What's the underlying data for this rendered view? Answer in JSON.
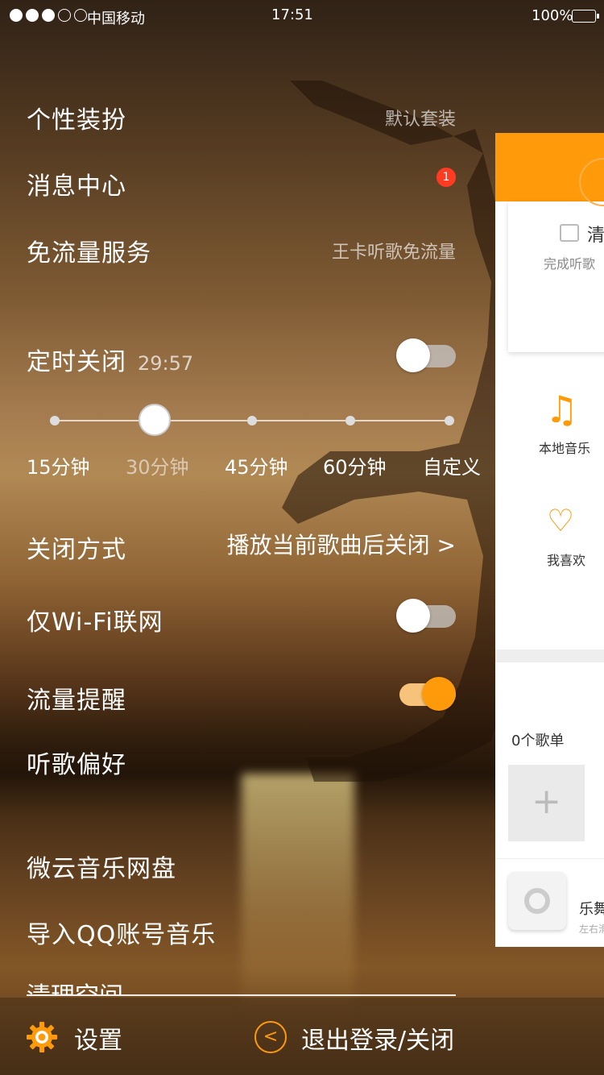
{
  "status_bar": {
    "carrier": "中国移动",
    "time": "17:51",
    "battery": "100%",
    "signal_filled": 3,
    "signal_total": 5
  },
  "menu": {
    "theme": {
      "label": "个性装扮",
      "value": "默认套装"
    },
    "messages": {
      "label": "消息中心",
      "badge": "1"
    },
    "free_data": {
      "label": "免流量服务",
      "value": "王卡听歌免流量"
    },
    "timer": {
      "label": "定时关闭",
      "countdown": "29:57",
      "enabled": false,
      "options": [
        "15分钟",
        "30分钟",
        "45分钟",
        "60分钟",
        "自定义"
      ],
      "selected_index": 1
    },
    "close_mode": {
      "label": "关闭方式",
      "value": "播放当前歌曲后关闭 >"
    },
    "wifi_only": {
      "label": "仅Wi-Fi联网",
      "enabled": false
    },
    "data_alert": {
      "label": "流量提醒",
      "enabled": true
    },
    "preferences": {
      "label": "听歌偏好"
    },
    "weiyun": {
      "label": "微云音乐网盘"
    },
    "import_qq": {
      "label": "导入QQ账号音乐"
    },
    "clear_space": {
      "label": "清理空间"
    }
  },
  "footer": {
    "settings": "设置",
    "logout": "退出登录/关闭"
  },
  "side_panel": {
    "card_label": "清",
    "checkin_text": "完成听歌",
    "local_music": "本地音乐",
    "favorites": "我喜欢",
    "playlist_count": "0个歌单",
    "add_symbol": "+",
    "song_title": "乐舞",
    "song_sub": "左右滑"
  },
  "colors": {
    "accent": "#ff9a0a",
    "badge": "#ff3b22"
  }
}
